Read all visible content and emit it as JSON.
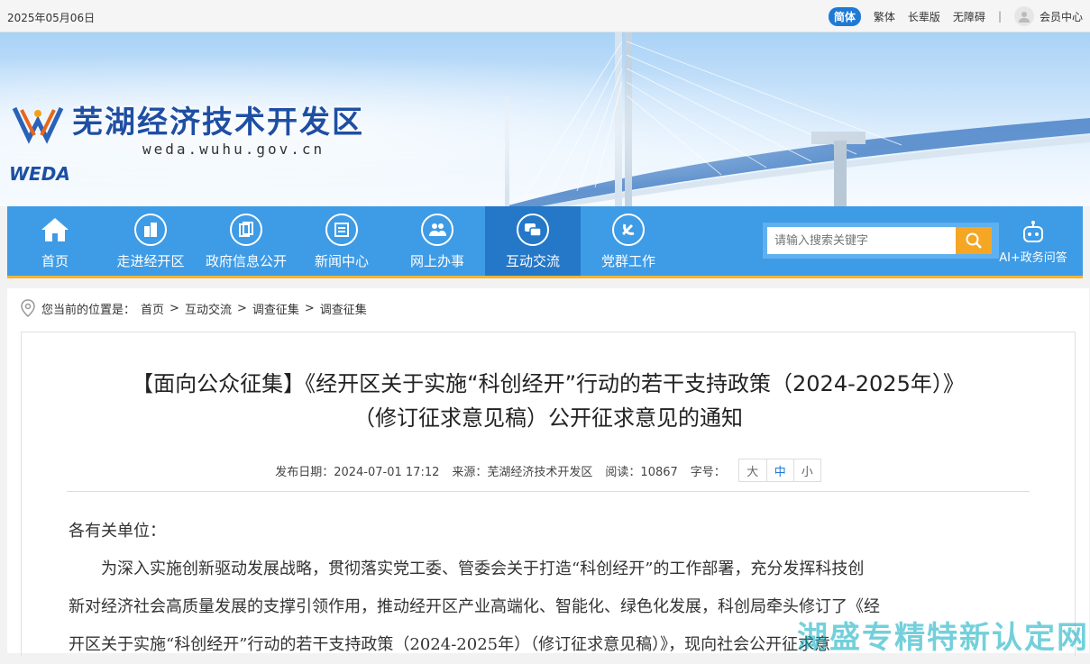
{
  "topbar": {
    "date": "2025年05月06日",
    "links": [
      "简体",
      "繁体",
      "长辈版",
      "无障碍"
    ],
    "separator": "|",
    "member": "会员中心"
  },
  "banner": {
    "site_title": "芜湖经济技术开发区",
    "domain": "weda.wuhu.gov.cn",
    "logo_text": "WEDA"
  },
  "nav": {
    "items": [
      {
        "label": "首页",
        "icon": "home-icon"
      },
      {
        "label": "走进经开区",
        "icon": "buildings-icon"
      },
      {
        "label": "政府信息公开",
        "icon": "documents-icon"
      },
      {
        "label": "新闻中心",
        "icon": "newspaper-icon"
      },
      {
        "label": "网上办事",
        "icon": "people-icon"
      },
      {
        "label": "互动交流",
        "icon": "chat-icon"
      },
      {
        "label": "党群工作",
        "icon": "party-emblem-icon"
      }
    ],
    "active_index": 5,
    "search_placeholder": "请输入搜索关键字",
    "ai_label": "AI+政务问答"
  },
  "breadcrumb": {
    "prefix": "您当前的位置是：",
    "items": [
      "首页",
      "互动交流",
      "调查征集",
      "调查征集"
    ],
    "sep": ">"
  },
  "article": {
    "title_line1": "【面向公众征集】《经开区关于实施“科创经开”行动的若干支持政策（2024-2025年）》",
    "title_line2": "（修订征求意见稿）公开征求意见的通知",
    "publish_label": "发布日期：",
    "publish_date": "2024-07-01 17:12",
    "source_label": "来源：",
    "source": "芜湖经济技术开发区",
    "views_label": "阅读：",
    "views": "10867",
    "fontsize_label": "字号：",
    "font_sizes": [
      "大",
      "中",
      "小"
    ],
    "salutation": "各有关单位：",
    "paragraph_lines": [
      "为深入实施创新驱动发展战略，贯彻落实党工委、管委会关于打造“科创经开”的工作部署，充分发挥科技创",
      "新对经济社会高质量发展的支撑引领作用，推动经开区产业高端化、智能化、绿色化发展，科创局牵头修订了《经",
      "开区关于实施“科创经开”行动的若干支持政策（2024-2025年）（修订征求意见稿）》，现向社会公开征求意"
    ],
    "watermark": "湖盛专精特新认定网"
  },
  "colors": {
    "nav_bg": "#3e9be6",
    "nav_active": "#2478c7",
    "accent": "#f5a623",
    "link_pill": "#1f7ad6"
  }
}
